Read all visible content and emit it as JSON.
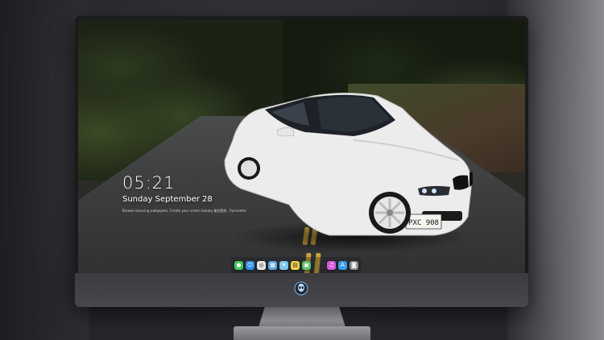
{
  "lockscreen": {
    "time": "05:21",
    "date": "Sunday September  28",
    "hint": "Browse stunning wallpapers, Create your screen beauty 美化壁纸 , Rainmeter"
  },
  "wallpaper": {
    "license_plate": "PXC 908"
  },
  "dock": {
    "apps": [
      {
        "name": "messages-icon",
        "glyph": "●",
        "color": "#3cc85a"
      },
      {
        "name": "finder-icon",
        "glyph": "☺",
        "color": "#2f8ee8"
      },
      {
        "name": "safari-icon",
        "glyph": "◎",
        "color": "#e8e8e8"
      },
      {
        "name": "preview-icon",
        "glyph": "▦",
        "color": "#5fa6e0"
      },
      {
        "name": "imovie-icon",
        "glyph": "✶",
        "color": "#7ec8f0"
      },
      {
        "name": "notes-icon",
        "glyph": "▤",
        "color": "#f3d34a"
      },
      {
        "name": "photos-icon",
        "glyph": "▣",
        "color": "#58c06a"
      },
      {
        "name": "itunes-icon",
        "glyph": "♫",
        "color": "#d55adf"
      },
      {
        "name": "appstore-icon",
        "glyph": "A",
        "color": "#3a9cf0"
      },
      {
        "name": "camera-icon",
        "glyph": "◙",
        "color": "#8a8a90"
      }
    ]
  },
  "colors": {
    "road_line": "#c9a23a",
    "car_body": "#eeeeee"
  }
}
